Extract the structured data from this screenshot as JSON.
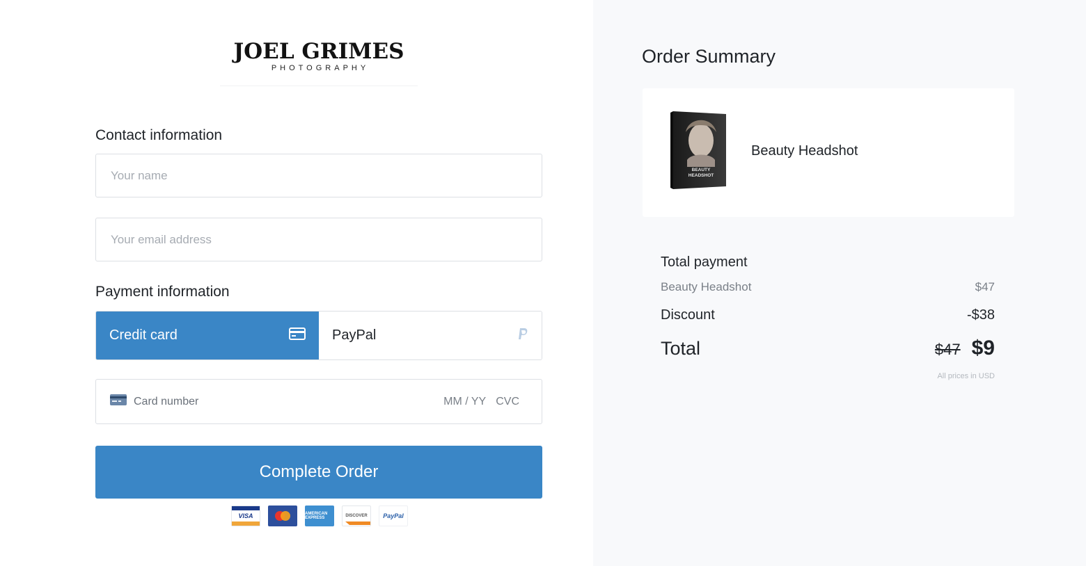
{
  "brand": {
    "name": "JOEL GRIMES",
    "tagline": "PHOTOGRAPHY"
  },
  "contact": {
    "title": "Contact information",
    "name_placeholder": "Your name",
    "email_placeholder": "Your email address"
  },
  "payment": {
    "title": "Payment information",
    "tabs": [
      {
        "label": "Credit card",
        "icon": "credit-card-icon",
        "selected": true
      },
      {
        "label": "PayPal",
        "icon": "paypal-icon",
        "selected": false
      }
    ],
    "card_number_placeholder": "Card number",
    "expiry_placeholder": "MM / YY",
    "cvc_placeholder": "CVC",
    "complete_label": "Complete Order",
    "accepted_logos": [
      {
        "name": "visa-logo",
        "text": "VISA"
      },
      {
        "name": "mastercard-logo",
        "text": ""
      },
      {
        "name": "american-express-logo",
        "text": "AMERICAN EXPRESS"
      },
      {
        "name": "discover-logo",
        "text": "DISCOVER"
      },
      {
        "name": "paypal-logo",
        "text": "PayPal"
      }
    ]
  },
  "summary": {
    "title": "Order Summary",
    "product_name": "Beauty Headshot",
    "product_image_text": "BEAUTY HEADSHOT",
    "total_title": "Total payment",
    "item_label": "Beauty Headshot",
    "item_price": "$47",
    "discount_label": "Discount",
    "discount_value": "-$38",
    "total_label": "Total",
    "total_old": "$47",
    "total_new": "$9",
    "currency_note": "All prices in USD"
  },
  "colors": {
    "accent": "#3a86c6",
    "summary_bg": "#f8f9fb"
  }
}
